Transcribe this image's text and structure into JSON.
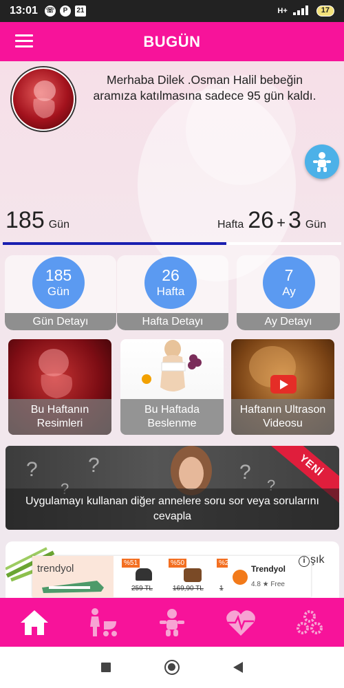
{
  "status": {
    "time": "13:01",
    "notif_pinterest": "P",
    "notif_date": "21",
    "network": "H+",
    "battery": "17"
  },
  "header": {
    "title": "BUGÜN"
  },
  "greeting": "Merhaba Dilek .Osman Halil  bebeğin aramıza katılmasına sadece 95 gün kaldı.",
  "progress": {
    "days": "185",
    "days_unit": "Gün",
    "week_prefix": "Hafta",
    "weeks": "26",
    "plus": "+",
    "extra_days": "3",
    "extra_unit": "Gün",
    "fraction": 0.66
  },
  "stats": [
    {
      "value": "185",
      "unit": "Gün",
      "footer": "Gün Detayı"
    },
    {
      "value": "26",
      "unit": "Hafta",
      "footer": "Hafta Detayı"
    },
    {
      "value": "7",
      "unit": "Ay",
      "footer": "Ay Detayı"
    }
  ],
  "tiles": [
    {
      "label": "Bu Haftanın Resimleri"
    },
    {
      "label": "Bu Haftada Beslenme"
    },
    {
      "label": "Haftanın Ultrason Videosu"
    }
  ],
  "banner": {
    "badge": "YENİ",
    "text": "Uygulamayı kullanan diğer annelere soru sor veya sorularını cevapla"
  },
  "ad": {
    "brand": "trendyol",
    "products": [
      {
        "discount": "%51",
        "price": "259 TL"
      },
      {
        "discount": "%50",
        "price": "169,90 TL"
      },
      {
        "discount": "%2",
        "price": "1"
      }
    ],
    "store_name": "Trendyol",
    "rating": "4.8 ★ Free",
    "info": "i",
    "tail_text": "şık"
  },
  "bottom_nav": [
    "home-icon",
    "mother-stroller-icon",
    "baby-icon",
    "heartbeat-icon",
    "settings-icon"
  ],
  "colors": {
    "primary": "#f7139a",
    "accent_blue": "#5b9af1",
    "progress": "#1a1fb0",
    "baby_button": "#4cb1e8"
  }
}
